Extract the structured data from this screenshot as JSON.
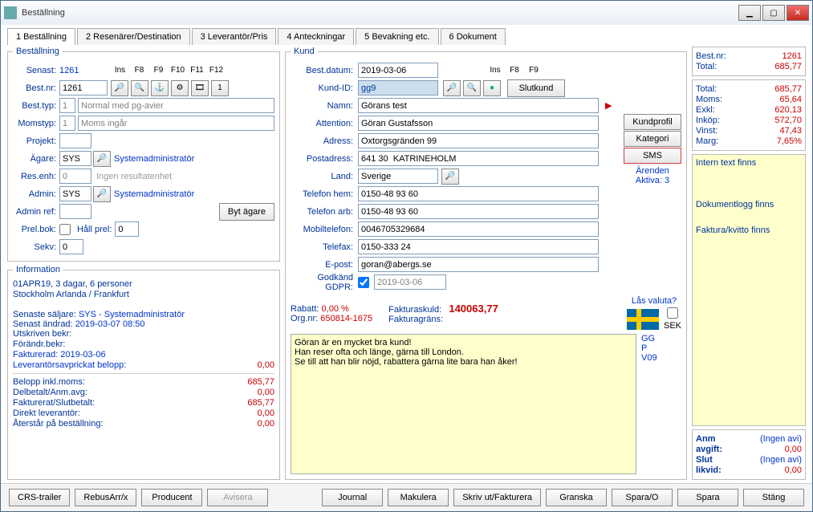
{
  "titlebar": {
    "title": "Beställning"
  },
  "tabs": {
    "t1": "1 Beställning",
    "t2": "2 Resenärer/Destination",
    "t3": "3 Leverantör/Pris",
    "t4": "4 Anteckningar",
    "t5": "5 Bevakning etc.",
    "t6": "6 Dokument"
  },
  "left": {
    "legend": "Beställning",
    "senast_lbl": "Senast:",
    "senast": "1261",
    "fkeys": [
      "Ins",
      "F8",
      "F9",
      "F10",
      "F11",
      "F12"
    ],
    "bestnr_lbl": "Best.nr:",
    "bestnr": "1261",
    "besttyp_lbl": "Best.typ:",
    "besttyp_code": "1",
    "besttyp_txt": "Normal med pg-avier",
    "moms_lbl": "Momstyp:",
    "moms_code": "1",
    "moms_txt": "Moms ingår",
    "projekt_lbl": "Projekt:",
    "projekt": "",
    "agare_lbl": "Ägare:",
    "agare": "SYS",
    "agare_txt": "Systemadministratör",
    "resenh_lbl": "Res.enh:",
    "resenh": "0",
    "resenh_txt": "Ingen resultatenhet",
    "admin_lbl": "Admin:",
    "admin": "SYS",
    "admin_txt": "Systemadministratör",
    "adminref_lbl": "Admin ref:",
    "adminref": "",
    "bytagare": "Byt ägare",
    "prelbok_lbl": "Prel.bok:",
    "hallprel_lbl": "Håll prel:",
    "hallprel": "0",
    "sekv_lbl": "Sekv:",
    "sekv": "0",
    "info_legend": "Information",
    "info_line1": "01APR19, 3 dagar, 6 personer",
    "info_line2": "Stockholm Arlanda / Frankfurt",
    "info_seller_k": "Senaste säljare:",
    "info_seller": "SYS - Systemadministratör",
    "info_changed_k": "Senast ändrad:",
    "info_changed": "2019-03-07 08:50",
    "info_utskr": "Utskriven bekr:",
    "info_forandr": "Förändr.bekr:",
    "info_fakt": "Fakturerad: 2019-03-06",
    "info_lev_k": "Leverantörsavprickat belopp:",
    "info_lev_v": "0,00",
    "info_belopp_k": "Belopp inkl.moms:",
    "info_belopp_v": "685,77",
    "info_delb_k": "Delbetalt/Anm.avg:",
    "info_delb_v": "0,00",
    "info_fakts_k": "Fakturerat/Slutbetalt:",
    "info_fakts_v": "685,77",
    "info_direkt_k": "Direkt leverantör:",
    "info_direkt_v": "0,00",
    "info_ater_k": "Återstår på beställning:",
    "info_ater_v": "0,00"
  },
  "kund": {
    "legend": "Kund",
    "bestdatum_lbl": "Best.datum:",
    "bestdatum": "2019-03-06",
    "fkeys": [
      "Ins",
      "F8",
      "F9"
    ],
    "kundid_lbl": "Kund-ID:",
    "kundid": "gg9",
    "slutkund": "Slutkund",
    "namn_lbl": "Namn:",
    "namn": "Görans test",
    "attention_lbl": "Attention:",
    "attention": "Göran Gustafsson",
    "adress_lbl": "Adress:",
    "adress": "Oxtorgsgränden 99",
    "postadr_lbl": "Postadress:",
    "postadr": "641 30  KATRINEHOLM",
    "land_lbl": "Land:",
    "land": "Sverige",
    "telhem_lbl": "Telefon hem:",
    "telhem": "0150-48 93 60",
    "telarb_lbl": "Telefon arb:",
    "telarb": "0150-48 93 60",
    "mobil_lbl": "Mobiltelefon:",
    "mobil": "0046705329684",
    "telefax_lbl": "Telefax:",
    "telefax": "0150-333 24",
    "epost_lbl": "E-post:",
    "epost": "goran@abergs.se",
    "gdpr_lbl": "Godkänd GDPR:",
    "gdpr_date": "2019-03-06",
    "kundprofil": "Kundprofil",
    "kategori": "Kategori",
    "sms": "SMS",
    "arenden": "Ärenden",
    "aktiva": "Aktiva: 3",
    "rabatt_lbl": "Rabatt:",
    "rabatt": "0,00 %",
    "orgnr_lbl": "Org.nr:",
    "orgnr": "650814-1675",
    "faktskuld_lbl": "Fakturaskuld:",
    "faktskuld": "140063,77",
    "faktgrans_lbl": "Fakturagräns:",
    "faktgrans": "",
    "lasvaluta": "Lås valuta?",
    "sek": "SEK",
    "codes": [
      "GG",
      "P",
      "V09"
    ],
    "note1": "Göran är en mycket bra kund!",
    "note2": "Han reser ofta och länge, gärna till London.",
    "note3": "Se till att han blir nöjd, rabattera gärna lite bara han åker!"
  },
  "right": {
    "bestnr_k": "Best.nr:",
    "bestnr": "1261",
    "total1_k": "Total:",
    "total1": "685,77",
    "total2_k": "Total:",
    "total2": "685,77",
    "moms_k": "Moms:",
    "moms": "65,64",
    "exkl_k": "Exkl:",
    "exkl": "620,13",
    "inkop_k": "Inköp:",
    "inkop": "572,70",
    "vinst_k": "Vinst:",
    "vinst": "47,43",
    "marg_k": "Marg:",
    "marg": "7,65%",
    "note1": "Intern text finns",
    "note2": "Dokumentlogg finns",
    "note3": "Faktura/kvitto finns",
    "anm_k": "Anm",
    "anm_v": "(Ingen avi)",
    "avgift_k": "avgift:",
    "avgift_v": "0,00",
    "slut_k": "Slut",
    "slut_v": "(Ingen avi)",
    "likvid_k": "likvid:",
    "likvid_v": "0,00"
  },
  "bottom": {
    "crs": "CRS-trailer",
    "rebus": "RebusArr/x",
    "producent": "Producent",
    "avisera": "Avisera",
    "journal": "Journal",
    "makulera": "Makulera",
    "skriv": "Skriv ut/Fakturera",
    "granska": "Granska",
    "sparao": "Spara/O",
    "spara": "Spara",
    "stang": "Stäng"
  }
}
